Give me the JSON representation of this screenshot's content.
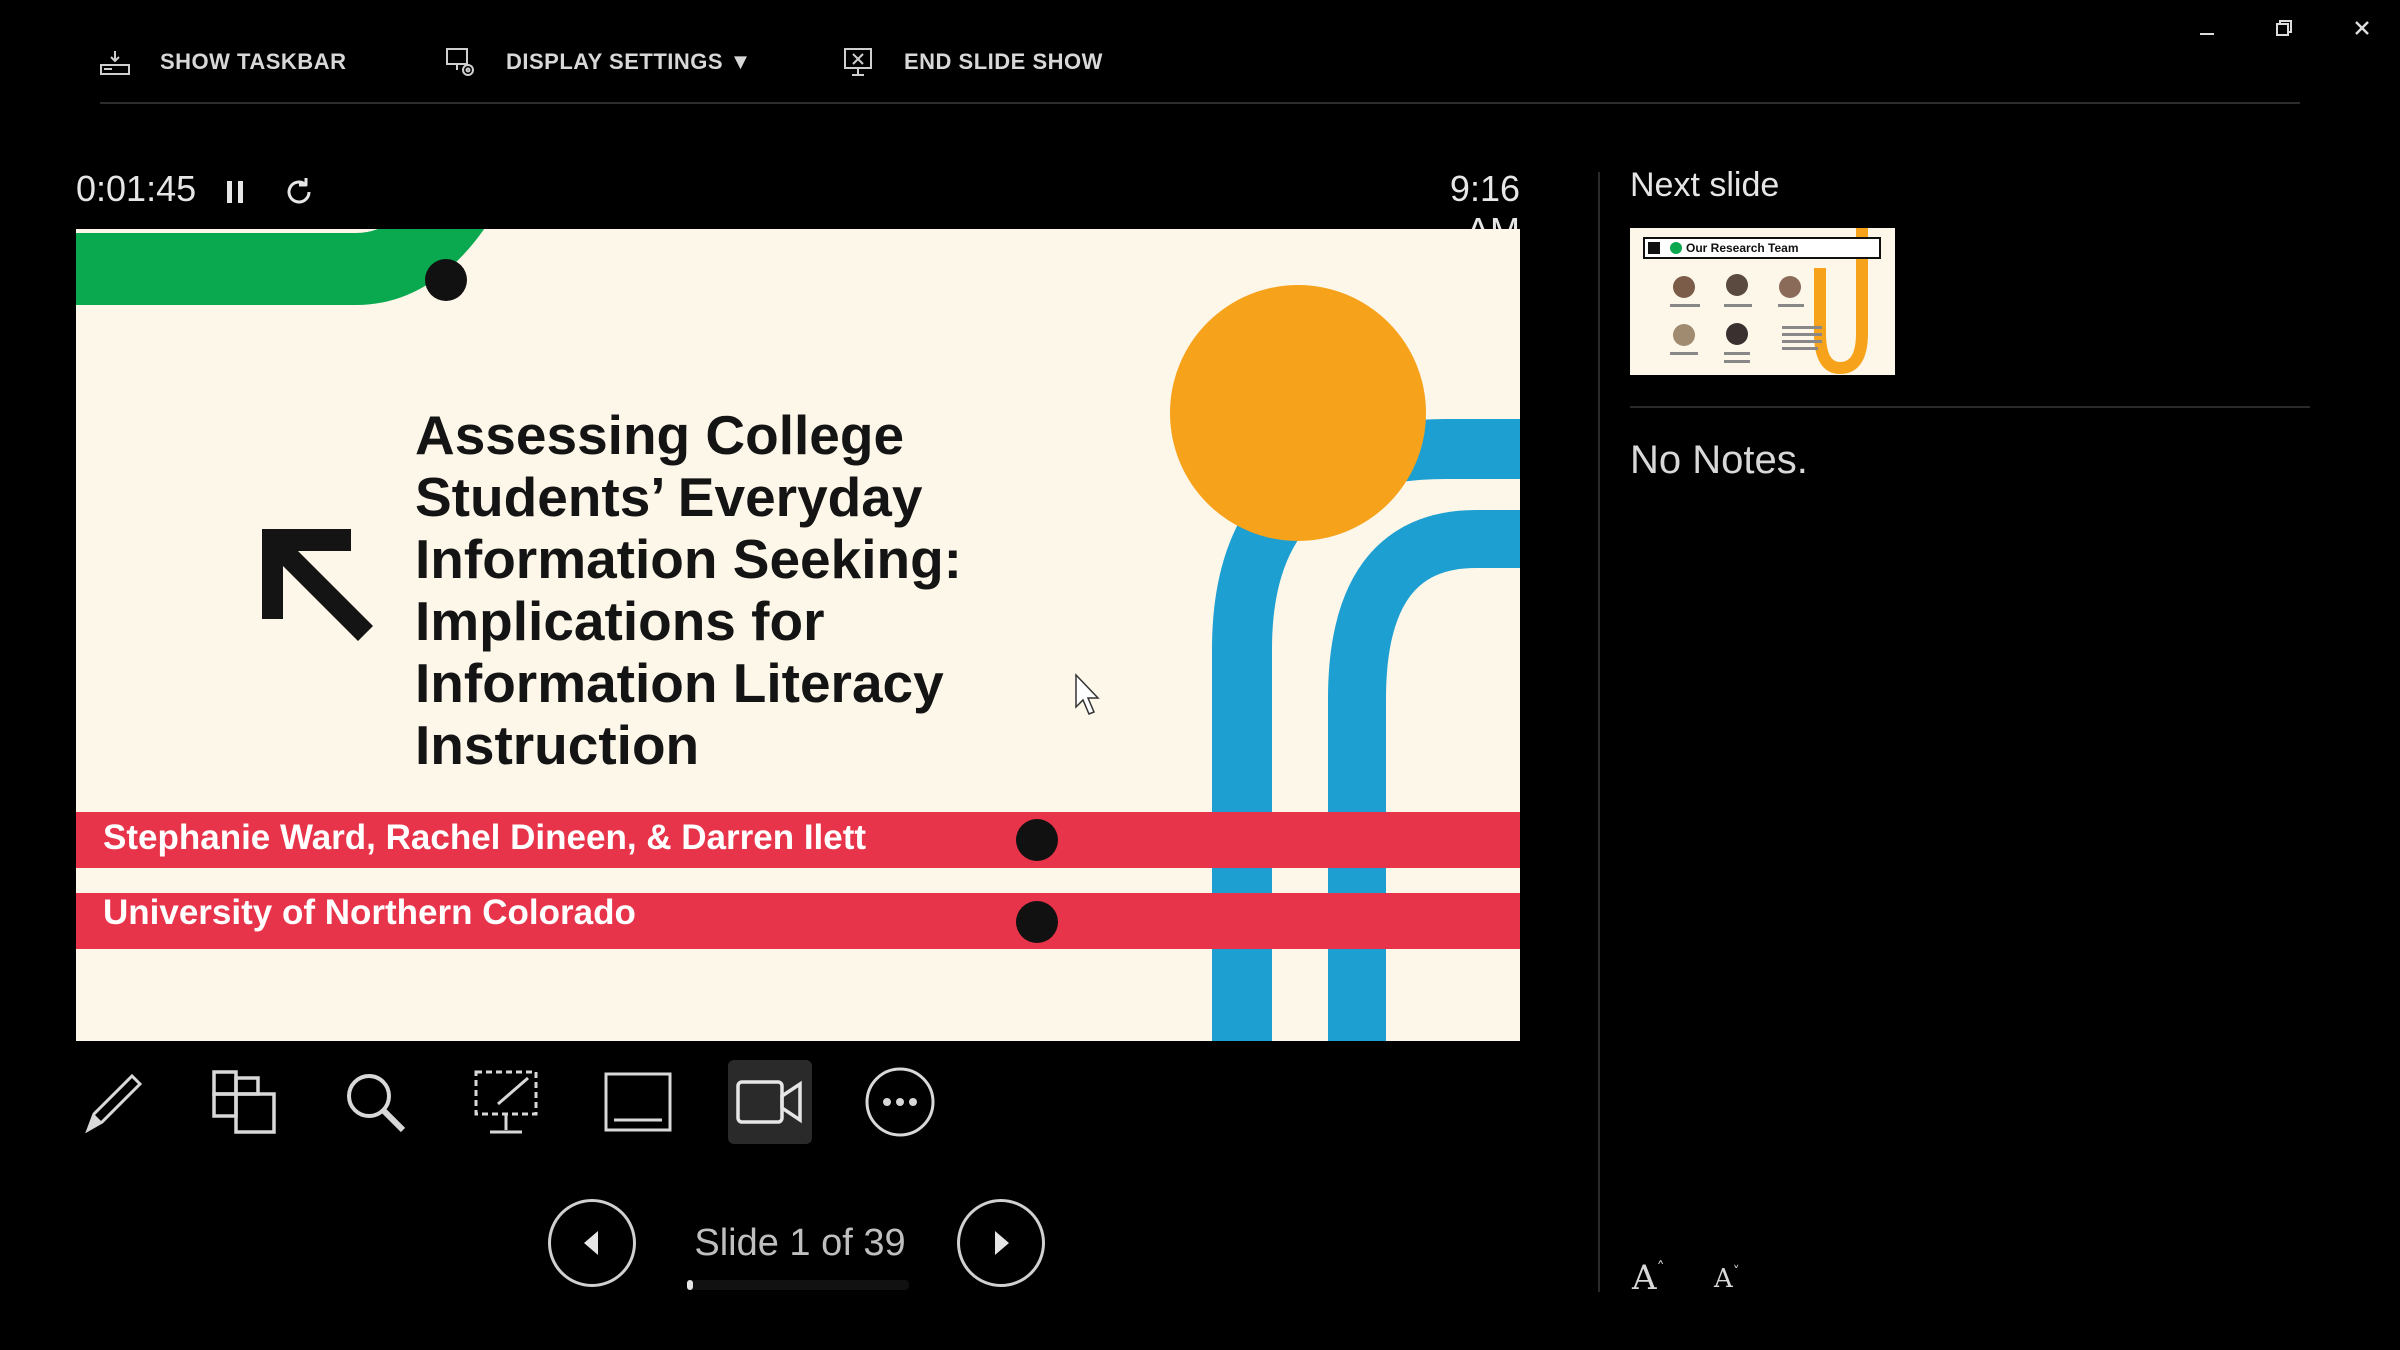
{
  "toolbar": {
    "show_taskbar": "SHOW TASKBAR",
    "display_settings": "DISPLAY SETTINGS ▼",
    "end_slide_show": "END SLIDE SHOW"
  },
  "presenter": {
    "elapsed_time": "0:01:45",
    "clock": "9:16 AM"
  },
  "slide": {
    "title": "Assessing College Students’ Everyday Information Seeking: Implications for Information Literacy Instruction",
    "authors": "Stephanie Ward, Rachel Dineen, & Darren Ilett",
    "institution": "University of Northern Colorado"
  },
  "navigation": {
    "counter": "Slide 1 of 39",
    "progress": 0.026
  },
  "next_slide": {
    "label": "Next slide",
    "thumb_title": "Our Research Team"
  },
  "notes": {
    "text": "No Notes."
  },
  "font_controls": {
    "increase": "A",
    "decrease": "A"
  },
  "colors": {
    "green": "#0aa84f",
    "orange": "#f7a21b",
    "blue": "#1d9fd1",
    "red": "#e8344a"
  },
  "icons": [
    "taskbar-icon",
    "display-settings-icon",
    "end-show-icon",
    "pause-icon",
    "restart-icon",
    "pen-icon",
    "see-all-slides-icon",
    "zoom-icon",
    "pointer-laser-icon",
    "subtitles-icon",
    "camera-icon",
    "more-options-icon"
  ]
}
